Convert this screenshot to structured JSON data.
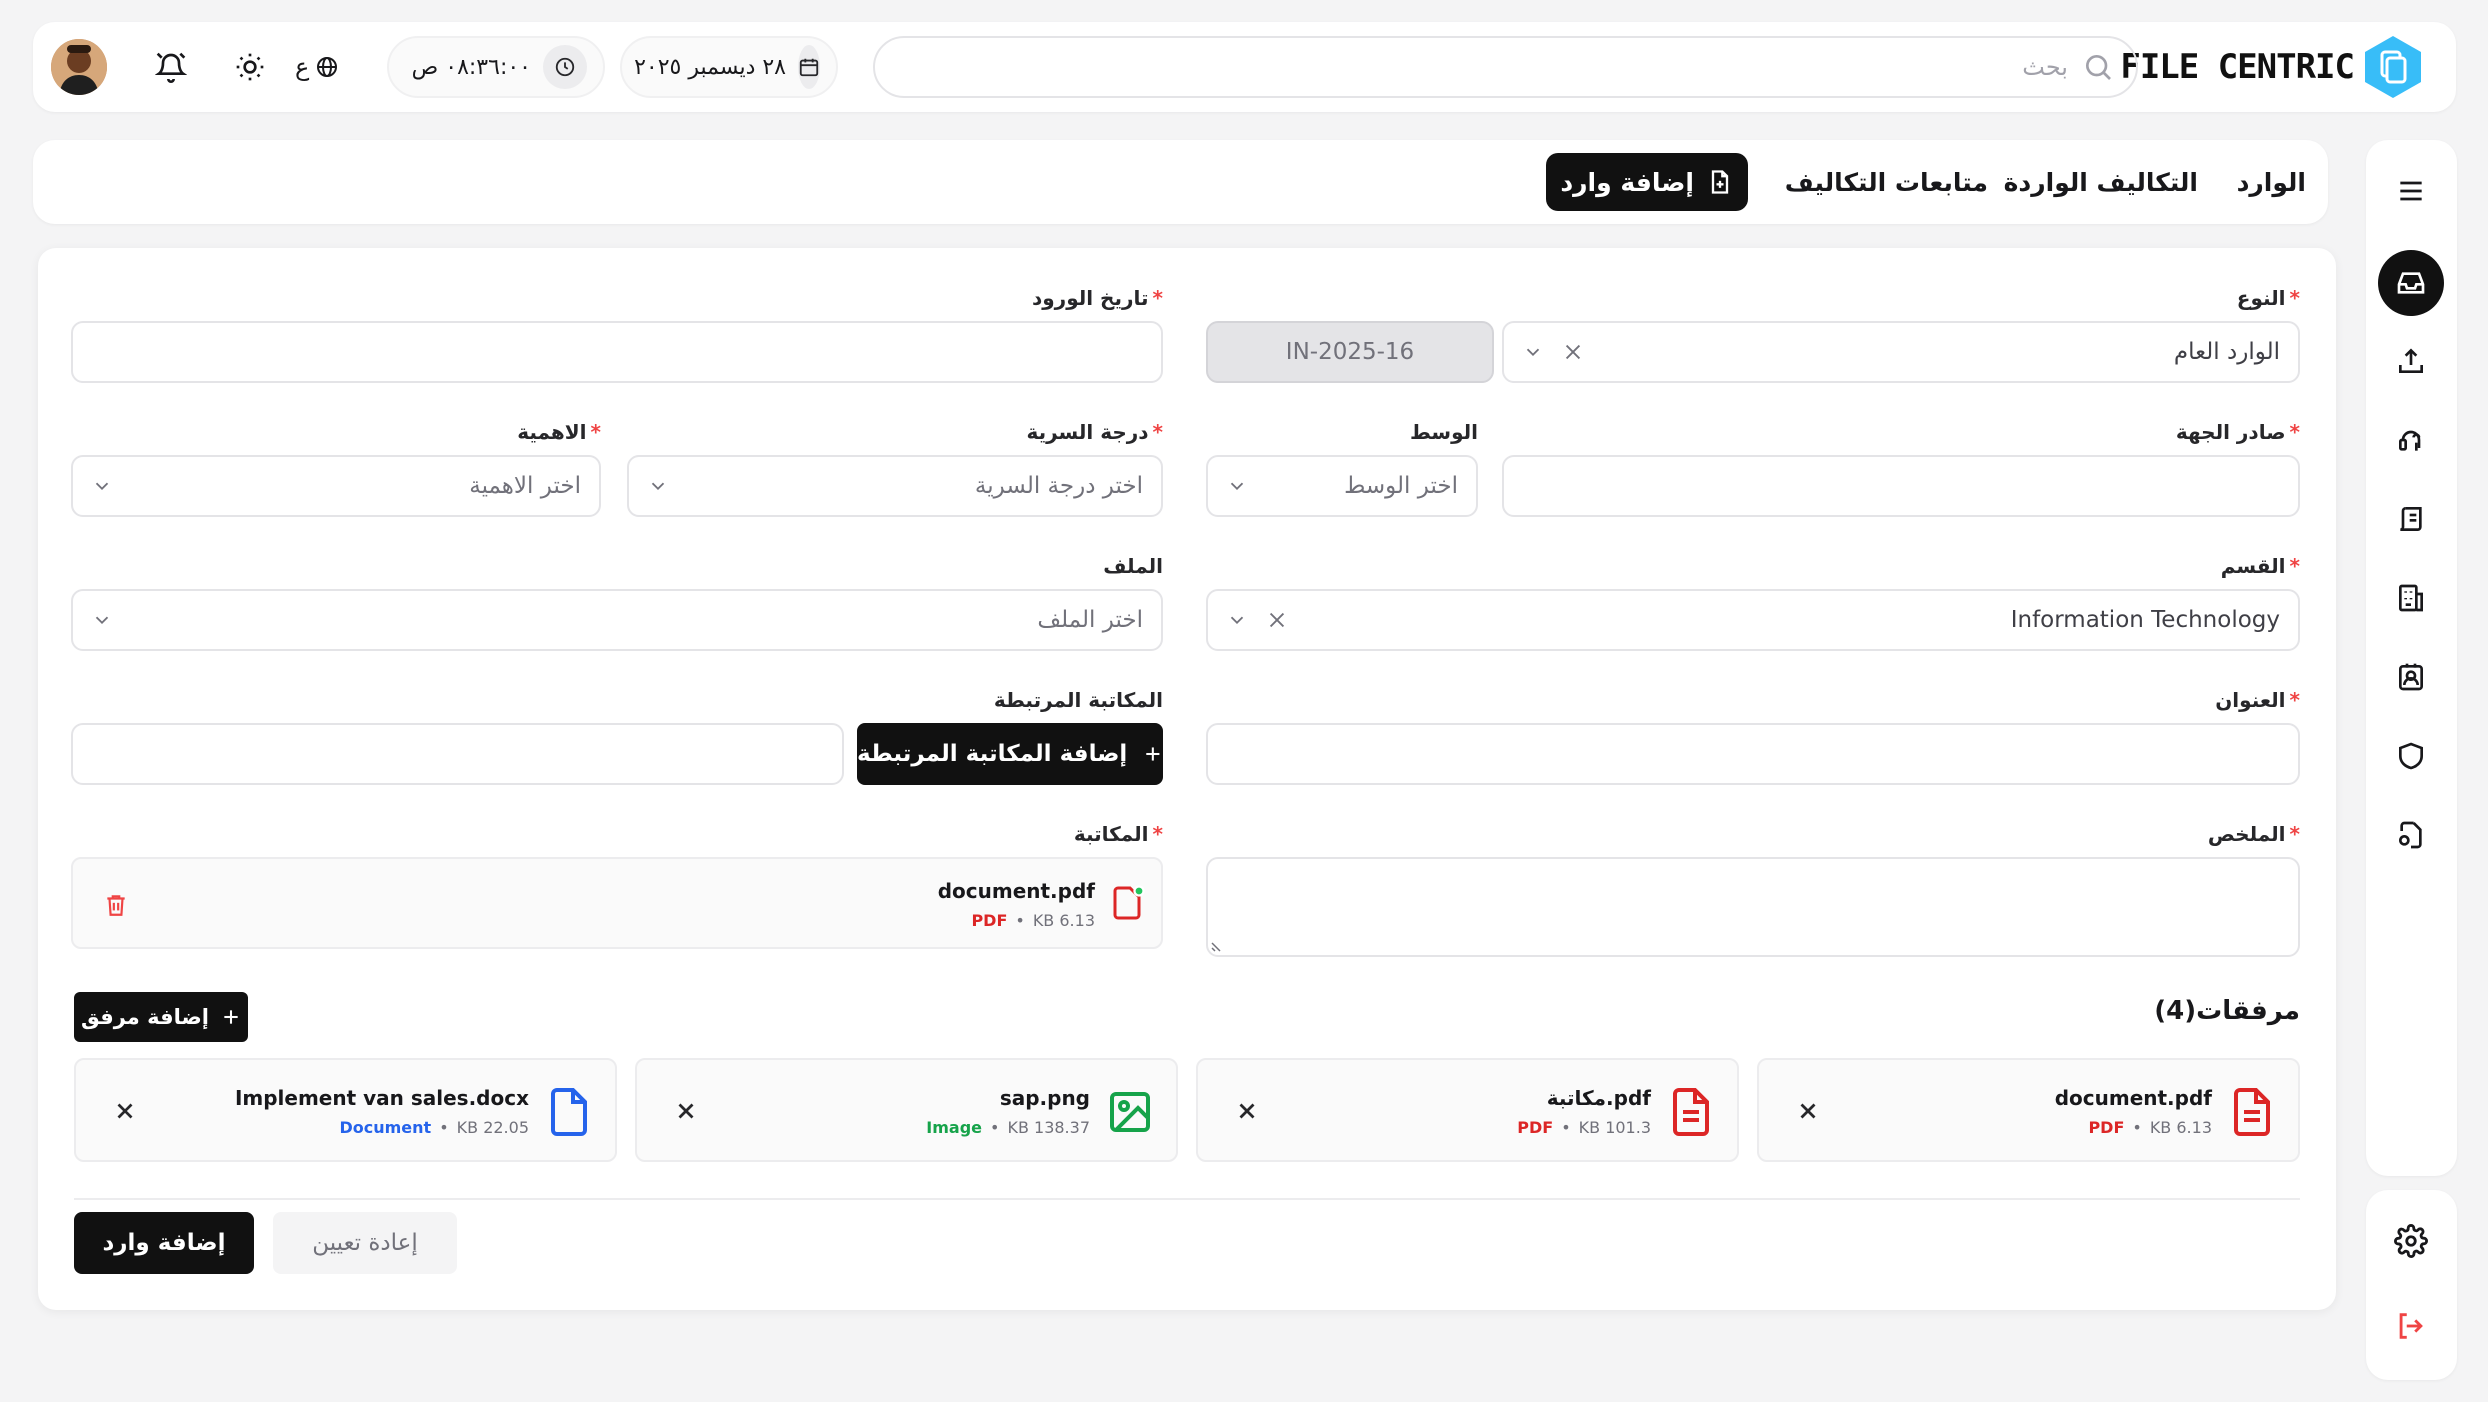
{
  "topbar": {
    "logo_text": "FILE CENTRIC",
    "search_placeholder": "بحث",
    "date": "٢٨ ديسمبر ٢٠٢٥",
    "time": "٠٨:٣٦:٠٠ ص",
    "language": "ع"
  },
  "tabs": {
    "inbox": "الوارد",
    "incoming_assignments": "التكاليف الواردة",
    "assignment_followups": "متابعات التكاليف",
    "add_incoming": "إضافة وارد"
  },
  "form": {
    "type": {
      "label": "النوع",
      "value": "الوارد العام"
    },
    "reference": {
      "value": "IN-2025-16"
    },
    "arrival_date": {
      "label": "تاريخ الورود",
      "value": ""
    },
    "issuer": {
      "label": "صادر الجهة",
      "value": ""
    },
    "medium": {
      "label": "الوسط",
      "placeholder": "اختر الوسط"
    },
    "confidentiality": {
      "label": "درجة السرية",
      "placeholder": "اختر درجة السرية"
    },
    "importance": {
      "label": "الاهمية",
      "placeholder": "اختر الاهمية"
    },
    "department": {
      "label": "القسم",
      "value": "Information Technology"
    },
    "file": {
      "label": "الملف",
      "placeholder": "اختر الملف"
    },
    "title": {
      "label": "العنوان",
      "value": ""
    },
    "related": {
      "label": "المكاتبة المرتبطة",
      "button": "إضافة المكاتبة المرتبطة",
      "value": ""
    },
    "summary": {
      "label": "الملخص",
      "value": ""
    },
    "correspondence": {
      "label": "المكاتبة",
      "file_name": "document.pdf",
      "file_type": "PDF",
      "file_size": "KB 6.13"
    },
    "attachments": {
      "title": "مرفقات(4)",
      "add_button": "إضافة مرفق",
      "items": [
        {
          "name": "document.pdf",
          "type": "PDF",
          "size": "KB 6.13"
        },
        {
          "name": "pdf.مكاتبة",
          "type": "PDF",
          "size": "KB 101.3"
        },
        {
          "name": "sap.png",
          "type": "Image",
          "size": "KB 138.37"
        },
        {
          "name": "Implement van sales.docx",
          "type": "Document",
          "size": "KB 22.05"
        }
      ]
    },
    "submit_button": "إضافة وارد",
    "reset_button": "إعادة تعيين"
  },
  "colors": {
    "accent": "#111111",
    "required": "#ef4444",
    "pdf": "#dc2626",
    "image": "#16a34a",
    "document": "#2563eb",
    "logo": "#38bdf8",
    "status_online": "#22c55e"
  },
  "icons": {
    "rail": [
      "menu-icon",
      "inbox-icon",
      "upload-icon",
      "headset-icon",
      "scroll-icon",
      "building-icon",
      "contact-icon",
      "shield-icon",
      "file-gear-icon",
      "settings-icon",
      "logout-icon"
    ]
  }
}
